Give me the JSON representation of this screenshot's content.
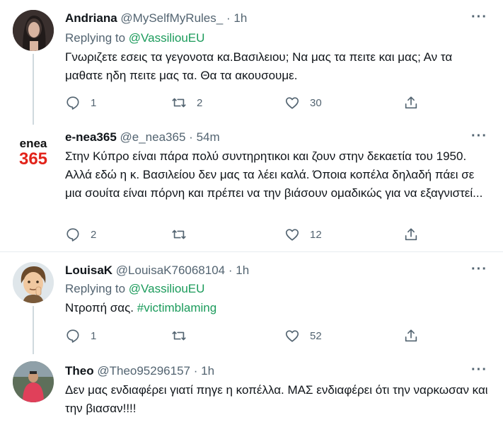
{
  "tweets": [
    {
      "name": "Andriana",
      "handle": "@MySelfMyRules_",
      "dot": "·",
      "time": "1h",
      "replying_prefix": "Replying to ",
      "replying_to": "@VassiliouEU",
      "text": "Γνωριζετε εσεις τα γεγονοτα κα.Βασιλειου; Να μας τα πειτε και μας; Αν τα μαθατε ηδη πειτε μας τα. Θα τα ακουσουμε.",
      "replies": "1",
      "retweets": "2",
      "likes": "30"
    },
    {
      "name": "e-nea365",
      "handle": "@e_nea365",
      "dot": "·",
      "time": "54m",
      "logo_top": "enea",
      "logo_bottom": "365",
      "text": "Στην Κύπρο είναι πάρα πολύ συντηρητικοι και ζουν στην δεκαετία του 1950. Αλλά εδώ η κ. Βασιλείου δεν μας τα λέει καλά. Όποια κοπέλα δηλαδή πάει σε μια σουίτα είναι πόρνη και πρέπει να την βιάσουν ομαδικώς για να εξαγνιστεί...",
      "replies": "2",
      "retweets": "",
      "likes": "12"
    },
    {
      "name": "LouisaK",
      "handle": "@LouisaK76068104",
      "dot": "·",
      "time": "1h",
      "replying_prefix": "Replying to ",
      "replying_to": "@VassiliouEU",
      "text_prefix": "Ντροπή σας. ",
      "hashtag": "#victimblaming",
      "replies": "1",
      "retweets": "",
      "likes": "52"
    },
    {
      "name": "Theo",
      "handle": "@Theo95296157",
      "dot": "·",
      "time": "1h",
      "text": "Δεν μας ενδιαφέρει γιατί πηγε η κοπέλλα. ΜΑΣ ενδιαφέρει ότι την ναρκωσαν και την βιασαν!!!!"
    }
  ],
  "more_label": "···",
  "colors": {
    "mention": "#1b9b5b",
    "muted": "#536471",
    "logo_red": "#e2231a"
  }
}
